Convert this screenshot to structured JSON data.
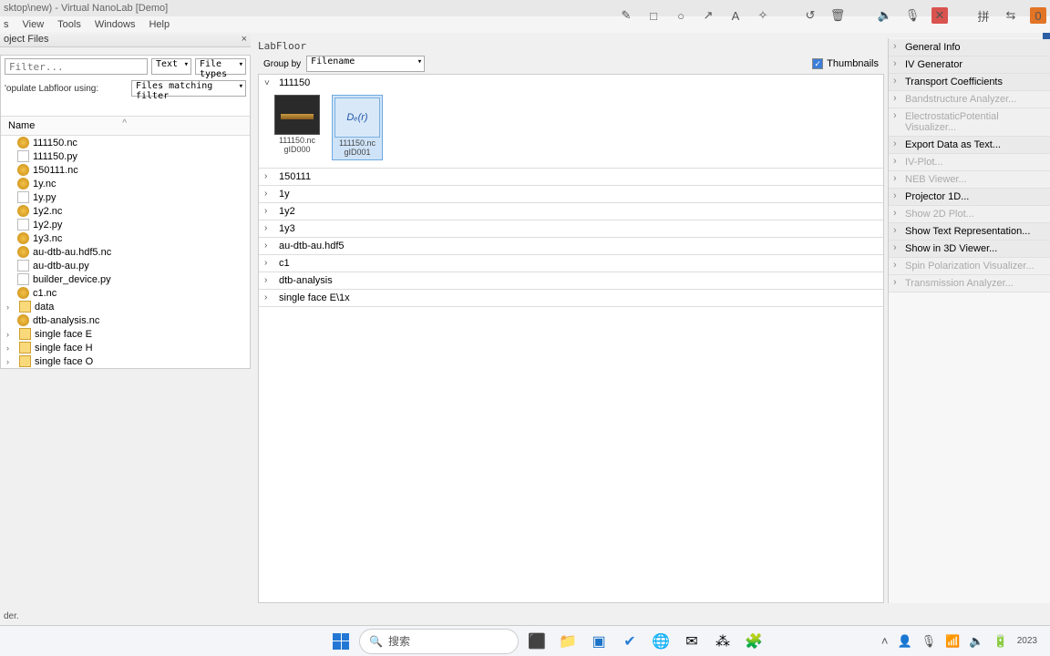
{
  "titlebar": "sktop\\new) - Virtual NanoLab [Demo]",
  "menu": {
    "items": [
      "s",
      "View",
      "Tools",
      "Windows",
      "Help"
    ]
  },
  "top_icons": [
    "✎",
    "□",
    "○",
    "↗",
    "A",
    "✧",
    "",
    "↺",
    "🗑",
    "",
    "🔈",
    "🎙",
    "✕",
    "",
    "拼",
    "⇆"
  ],
  "project_panel": {
    "title": "oject Files",
    "filter_placeholder": "Filter...",
    "text_combo": "Text",
    "filetypes_combo": "File types",
    "populate_label": "'opulate Labfloor using:",
    "populate_combo": "Files matching filter",
    "tree_header": "Name",
    "items": [
      {
        "icon": "nc",
        "label": "111150.nc"
      },
      {
        "icon": "py",
        "label": "111150.py"
      },
      {
        "icon": "nc",
        "label": "150111.nc"
      },
      {
        "icon": "nc",
        "label": "1y.nc"
      },
      {
        "icon": "py",
        "label": "1y.py"
      },
      {
        "icon": "nc",
        "label": "1y2.nc"
      },
      {
        "icon": "py",
        "label": "1y2.py"
      },
      {
        "icon": "nc",
        "label": "1y3.nc"
      },
      {
        "icon": "nc",
        "label": "au-dtb-au.hdf5.nc"
      },
      {
        "icon": "py",
        "label": "au-dtb-au.py"
      },
      {
        "icon": "py",
        "label": "builder_device.py"
      },
      {
        "icon": "nc",
        "label": "c1.nc"
      },
      {
        "icon": "folder",
        "label": "data",
        "expand": true
      },
      {
        "icon": "nc",
        "label": "dtb-analysis.nc"
      },
      {
        "icon": "folder",
        "label": "single face E",
        "expand": true
      },
      {
        "icon": "folder",
        "label": "single face H",
        "expand": true
      },
      {
        "icon": "folder",
        "label": "single face O",
        "expand": true
      }
    ]
  },
  "labfloor": {
    "title": "LabFloor",
    "groupby_label": "Group by",
    "groupby_combo": "Filename",
    "thumbnails_label": "Thumbnails",
    "groups": [
      {
        "name": "111150",
        "open": true,
        "thumbs": [
          {
            "label1": "111150.nc",
            "label2": "gID000",
            "dark": true
          },
          {
            "label1": "111150.nc",
            "label2": "gID001",
            "formula": "Dₑ(r)",
            "selected": true
          }
        ]
      },
      {
        "name": "150111"
      },
      {
        "name": "1y"
      },
      {
        "name": "1y2"
      },
      {
        "name": "1y3"
      },
      {
        "name": "au-dtb-au.hdf5"
      },
      {
        "name": "c1"
      },
      {
        "name": "dtb-analysis"
      },
      {
        "name": "single face E\\1x"
      }
    ]
  },
  "right_panel": [
    {
      "label": "General Info",
      "enabled": true
    },
    {
      "label": "IV Generator",
      "enabled": true
    },
    {
      "label": "Transport Coefficients",
      "enabled": true
    },
    {
      "label": "Bandstructure Analyzer...",
      "enabled": false
    },
    {
      "label": "ElectrostaticPotential Visualizer...",
      "enabled": false
    },
    {
      "label": "Export Data as Text...",
      "enabled": true
    },
    {
      "label": "IV-Plot...",
      "enabled": false
    },
    {
      "label": "NEB Viewer...",
      "enabled": false
    },
    {
      "label": "Projector 1D...",
      "enabled": true
    },
    {
      "label": "Show 2D Plot...",
      "enabled": false
    },
    {
      "label": "Show Text Representation...",
      "enabled": true
    },
    {
      "label": "Show in 3D Viewer...",
      "enabled": true
    },
    {
      "label": "Spin Polarization Visualizer...",
      "enabled": false
    },
    {
      "label": "Transmission Analyzer...",
      "enabled": false
    }
  ],
  "statusbar": "der.",
  "taskbar": {
    "search_placeholder": "搜索",
    "year": "2023"
  }
}
